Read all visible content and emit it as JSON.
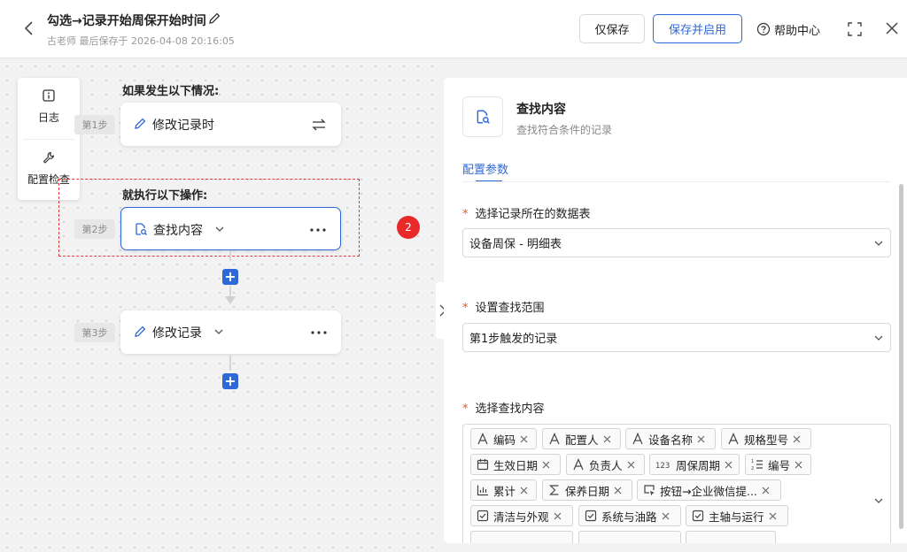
{
  "header": {
    "title": "勾选→记录开始周保开始时间",
    "subtitle": "古老师 最后保存于 2026-04-08 20:16:05",
    "save_label": "仅保存",
    "save_enable_label": "保存并启用",
    "help_label": "帮助中心"
  },
  "side_tools": {
    "log_label": "日志",
    "check_label": "配置检查"
  },
  "flow": {
    "trigger_heading": "如果发生以下情况:",
    "action_heading": "就执行以下操作:",
    "steps": [
      {
        "tag": "第1步",
        "label": "修改记录时"
      },
      {
        "tag": "第2步",
        "label": "查找内容"
      },
      {
        "tag": "第3步",
        "label": "修改记录"
      }
    ],
    "badge": "2"
  },
  "panel": {
    "title": "查找内容",
    "description": "查找符合条件的记录",
    "tab_label": "配置参数",
    "field1_label": "选择记录所在的数据表",
    "field1_value": "设备周保 - 明细表",
    "field2_label": "设置查找范围",
    "field2_value": "第1步触发的记录",
    "field3_label": "选择查找内容",
    "tags": [
      {
        "label": "编码",
        "icon": "text-icon"
      },
      {
        "label": "配置人",
        "icon": "text-icon"
      },
      {
        "label": "设备名称",
        "icon": "text-icon"
      },
      {
        "label": "规格型号",
        "icon": "text-icon"
      },
      {
        "label": "生效日期",
        "icon": "calendar-icon"
      },
      {
        "label": "负责人",
        "icon": "text-icon"
      },
      {
        "label": "周保周期",
        "icon": "number-icon"
      },
      {
        "label": "编号",
        "icon": "ordered-list-icon"
      },
      {
        "label": "累计",
        "icon": "bar-chart-icon"
      },
      {
        "label": "保养日期",
        "icon": "sum-icon"
      },
      {
        "label": "按钮→企业微信提...",
        "icon": "button-icon"
      },
      {
        "label": "清洁与外观",
        "icon": "checkbox-icon"
      },
      {
        "label": "系统与油路",
        "icon": "checkbox-icon"
      },
      {
        "label": "主轴与运行",
        "icon": "checkbox-icon"
      }
    ]
  },
  "colors": {
    "accent": "#2f68d8",
    "danger": "#e03a3a",
    "required": "#e05a2a"
  }
}
